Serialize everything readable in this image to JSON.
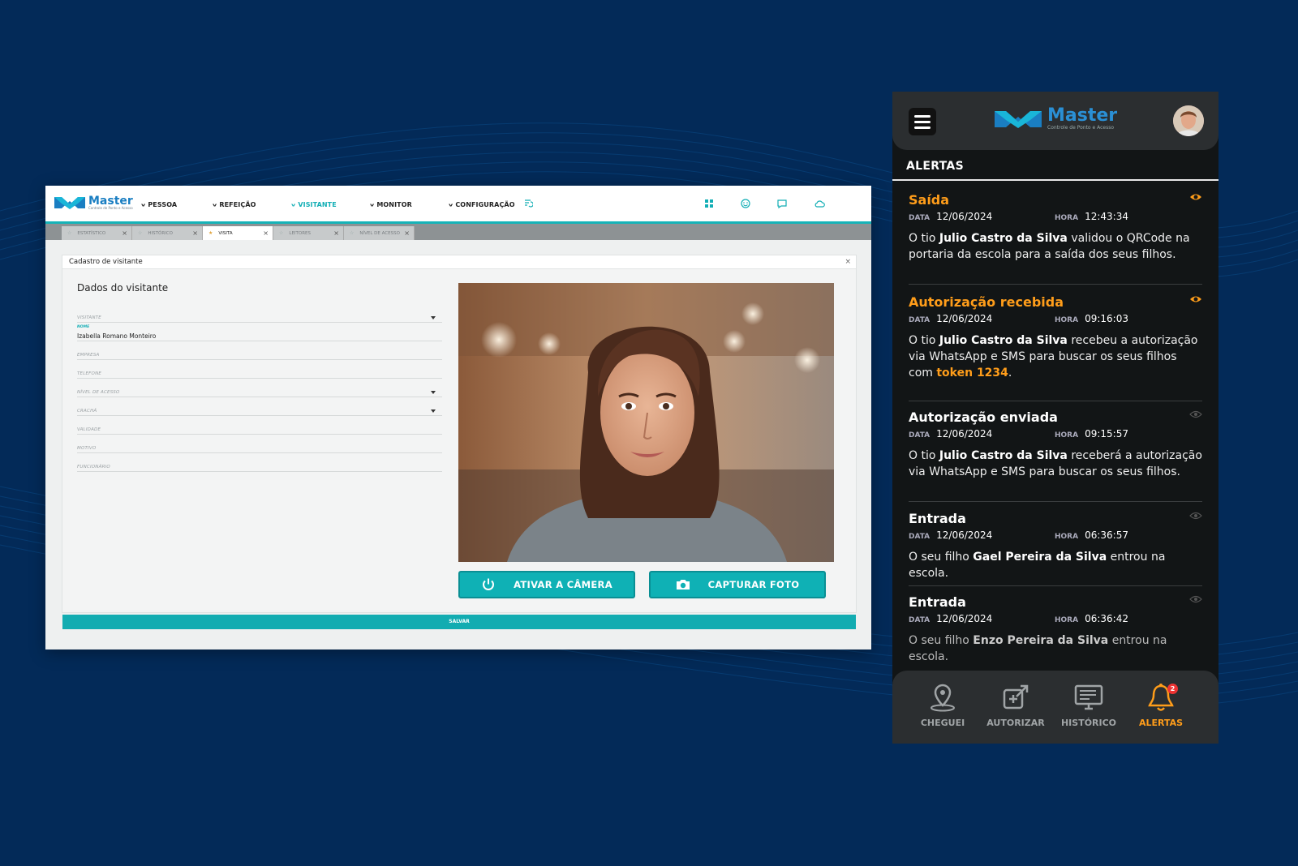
{
  "desktop": {
    "brand": {
      "name": "Master",
      "tagline": "Controle de Ponto e Acesso"
    },
    "nav": [
      "PESSOA",
      "REFEIÇÃO",
      "VISITANTE",
      "MONITOR",
      "CONFIGURAÇÃO"
    ],
    "active_nav": "VISITANTE",
    "toolbar_icons": [
      "grid-icon",
      "face-icon",
      "chat-icon",
      "cloud-icon"
    ],
    "tabs": [
      {
        "label": "ESTATÍSTICO",
        "active": false
      },
      {
        "label": "HISTÓRICO",
        "active": false
      },
      {
        "label": "VISITA",
        "active": true
      },
      {
        "label": "LEITORES",
        "active": false
      },
      {
        "label": "NÍVEL DE ACESSO",
        "active": false
      }
    ],
    "panel_title": "Cadastro de visitante",
    "form_title": "Dados do visitante",
    "fields": {
      "visitante": {
        "label": "VISITANTE",
        "value": ""
      },
      "nome": {
        "label": "NOME",
        "value": "Izabella Romano Monteiro"
      },
      "empresa": {
        "label": "EMPRESA",
        "value": ""
      },
      "telefone": {
        "label": "TELEFONE",
        "value": ""
      },
      "nivel": {
        "label": "NÍVEL DE ACESSO",
        "value": ""
      },
      "cracha": {
        "label": "CRACHÁ",
        "value": ""
      },
      "validade": {
        "label": "VALIDADE",
        "value": ""
      },
      "motivo": {
        "label": "MOTIVO",
        "value": ""
      },
      "funcionario": {
        "label": "FUNCIONÁRIO",
        "value": ""
      }
    },
    "buttons": {
      "camera": "ATIVAR A CÂMERA",
      "capture": "CAPTURAR FOTO",
      "save": "SALVAR"
    },
    "accent": "#12aeb5"
  },
  "mobile": {
    "brand": {
      "name": "Master",
      "tagline": "Controle de Ponto e Acesso"
    },
    "section_title": "ALERTAS",
    "labels": {
      "data": "DATA",
      "hora": "HORA"
    },
    "alerts": [
      {
        "title": "Saída",
        "date": "12/06/2024",
        "time": "12:43:34",
        "m1": "O tio ",
        "name": "Julio Castro da Silva",
        "m2": " validou o QRCode na portaria da escola para a saída dos seus filhos."
      },
      {
        "title": "Autorização recebida",
        "date": "12/06/2024",
        "time": "09:16:03",
        "m1": "O tio ",
        "name": "Julio Castro da Silva",
        "m2": " recebeu a autorização via WhatsApp e SMS para buscar os seus filhos com ",
        "token": "token 1234",
        "m3": "."
      },
      {
        "title": "Autorização enviada",
        "date": "12/06/2024",
        "time": "09:15:57",
        "m1": "O tio ",
        "name": "Julio Castro da Silva",
        "m2": " receberá a autorização via WhatsApp e SMS para buscar os seus filhos."
      },
      {
        "title": "Entrada",
        "date": "12/06/2024",
        "time": "06:36:57",
        "m1": "O seu filho ",
        "name": "Gael Pereira da Silva",
        "m2": " entrou na escola."
      },
      {
        "title": "Entrada",
        "date": "12/06/2024",
        "time": "06:36:42",
        "m1": "O seu filho ",
        "name": "Enzo Pereira da Silva",
        "m2": " entrou na escola."
      }
    ],
    "bottom_nav": [
      "CHEGUEI",
      "AUTORIZAR",
      "HISTÓRICO",
      "ALERTAS"
    ],
    "active_bottom": "ALERTAS",
    "alert_badge": "2",
    "accent": "#ff9d1a"
  }
}
